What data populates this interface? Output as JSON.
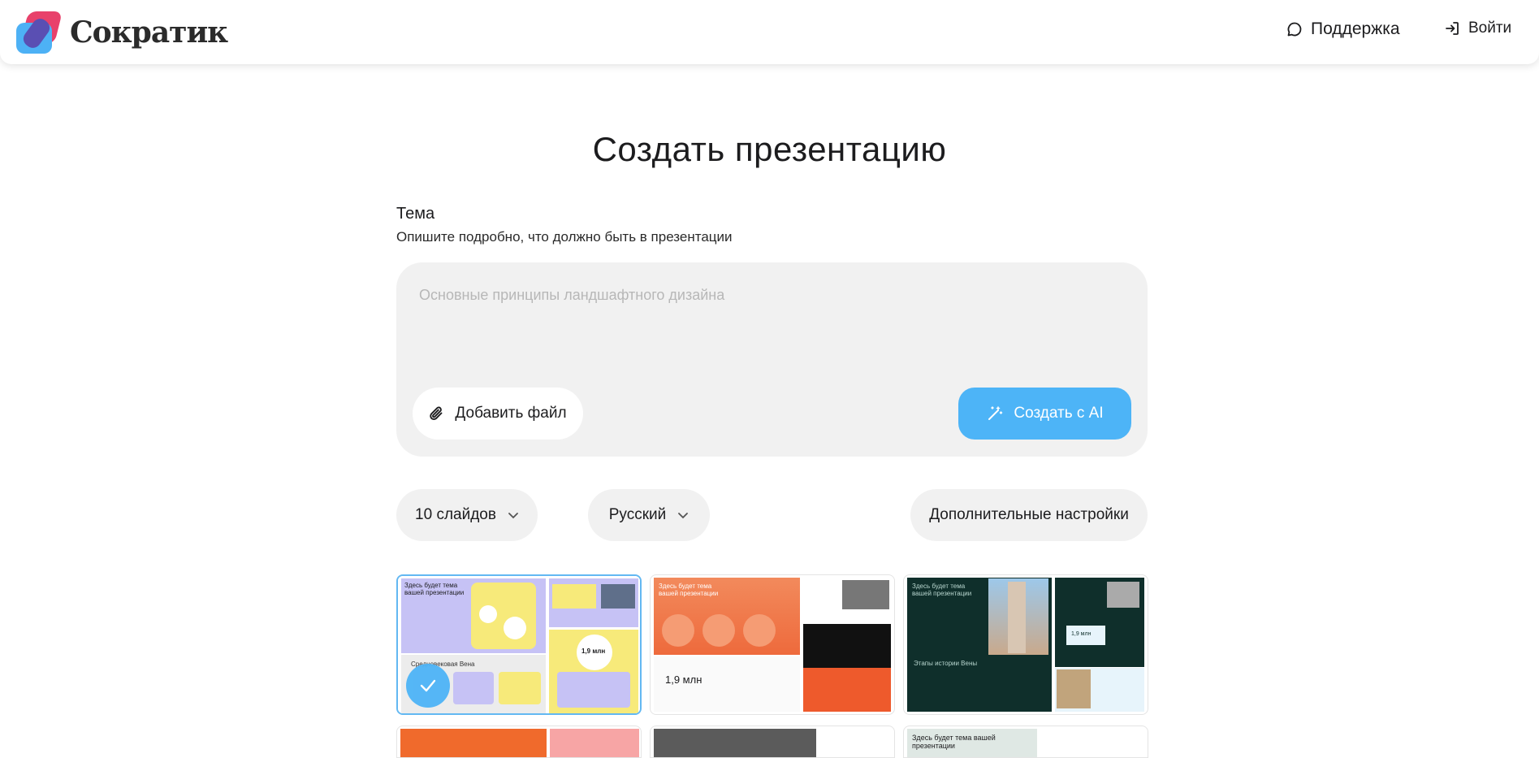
{
  "header": {
    "brand": "Сократик",
    "support_label": "Поддержка",
    "login_label": "Войти"
  },
  "main": {
    "title": "Создать презентацию",
    "topic_label": "Тема",
    "topic_hint": "Опишите подробно, что должно быть в презентации",
    "topic_placeholder": "Основные принципы ландшафтного дизайна",
    "add_file_label": "Добавить файл",
    "create_ai_label": "Создать с AI"
  },
  "options": {
    "slides_label": "10 слайдов",
    "language_label": "Русский",
    "advanced_label": "Дополнительные настройки"
  },
  "templates": [
    {
      "theme_text": "Здесь будет тема вашей презентации",
      "stat": "1,9 млн",
      "caption": "Средневековая Вена"
    },
    {
      "theme_text": "Здесь будет тема вашей презентации",
      "stat": "1,9 млн"
    },
    {
      "theme_text": "Здесь будет тема вашей презентации",
      "stat": "1,9 млн",
      "caption": "Этапы истории Вены"
    }
  ],
  "templates_row2": [
    {
      "theme_text": ""
    },
    {
      "theme_text": ""
    },
    {
      "theme_text": "Здесь будет тема вашей презентации"
    }
  ],
  "colors": {
    "accent": "#4db4f7",
    "field_bg": "#f1f1f1",
    "logo_pink": "#e8416b",
    "logo_purple": "#5a4fb3"
  }
}
